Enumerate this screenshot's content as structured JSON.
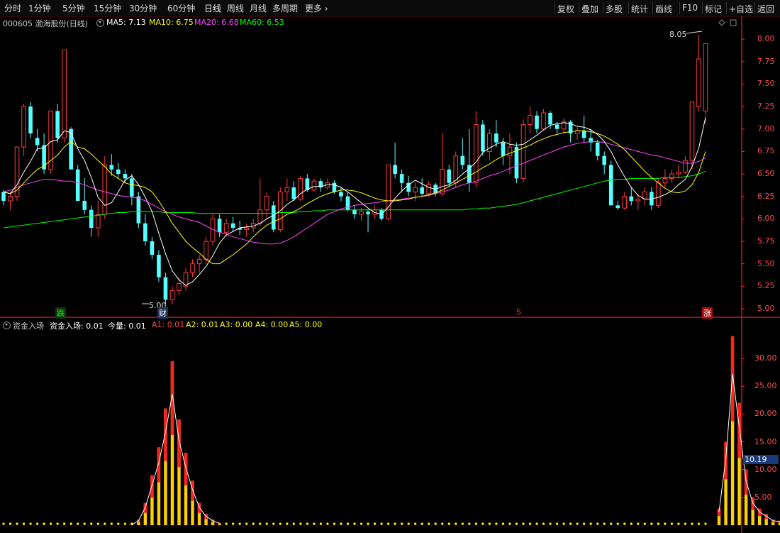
{
  "toolbar": {
    "left_items": [
      "分时",
      "1分钟",
      "5分钟",
      "15分钟",
      "30分钟",
      "60分钟",
      "日线",
      "周线",
      "月线",
      "多周期",
      "更多"
    ],
    "active_label": "日线",
    "right_items": [
      "复权",
      "叠加",
      "多股",
      "统计",
      "画线",
      "F10",
      "标记",
      "+自选",
      "返回"
    ]
  },
  "info": {
    "stock_name": "000605 渤海股份(日线)",
    "ma5": "MA5: 7.13",
    "ma10": "MA10: 6.75",
    "ma20": "MA20: 6.68",
    "ma60": "MA60: 6.53"
  },
  "indicator_info": {
    "name": "资金入场",
    "l1": "资金入场: 0.01",
    "l2": "今量: 0.01",
    "a1": "A1: 0.01",
    "a2": "A2: 0.01",
    "a3": "A3: 0.00",
    "a4": "A4: 0.00",
    "a5": "A5: 0.00"
  },
  "colors": {
    "up": "#ff3c3c",
    "down": "#54ffff",
    "ma5": "#ffffff",
    "ma10": "#ffff00",
    "ma20": "#ff44ff",
    "ma60": "#00ff00",
    "axis": "#ff3232",
    "axis_text": "#ff4d4d"
  },
  "markers": {
    "high_label": "8.05",
    "low_label": "5.00",
    "fall": "跌",
    "fin": "财",
    "s": "S",
    "rise": "涨",
    "ind_value": "10.19"
  },
  "chart_data": [
    {
      "type": "candlestick",
      "y_ticks": [
        "8.00",
        "7.75",
        "7.50",
        "7.25",
        "7.00",
        "6.75",
        "6.50",
        "6.25",
        "6.00",
        "5.75",
        "5.50",
        "5.25",
        "5.00"
      ],
      "ylim": [
        4.96,
        8.12
      ],
      "ohlc": [
        [
          6.3,
          6.32,
          6.15,
          6.2
        ],
        [
          6.2,
          6.3,
          6.1,
          6.25
        ],
        [
          6.25,
          6.8,
          6.2,
          6.8
        ],
        [
          6.8,
          7.28,
          6.7,
          7.25
        ],
        [
          7.25,
          7.3,
          6.9,
          6.95
        ],
        [
          6.9,
          7.0,
          6.75,
          6.82
        ],
        [
          6.82,
          6.95,
          6.5,
          6.55
        ],
        [
          6.55,
          7.2,
          6.5,
          7.2
        ],
        [
          7.2,
          7.28,
          6.85,
          6.9
        ],
        [
          6.9,
          7.88,
          6.85,
          7.88
        ],
        [
          7.0,
          7.02,
          6.55,
          6.55
        ],
        [
          6.55,
          6.6,
          6.2,
          6.2
        ],
        [
          6.2,
          6.45,
          6.05,
          6.1
        ],
        [
          6.1,
          6.15,
          5.8,
          5.9
        ],
        [
          5.9,
          6.2,
          5.8,
          6.05
        ],
        [
          6.05,
          6.7,
          6.0,
          6.6
        ],
        [
          6.6,
          6.72,
          6.48,
          6.55
        ],
        [
          6.55,
          6.62,
          6.45,
          6.5
        ],
        [
          6.5,
          6.55,
          6.4,
          6.45
        ],
        [
          6.45,
          6.5,
          6.15,
          6.25
        ],
        [
          6.25,
          6.3,
          5.9,
          5.95
        ],
        [
          5.95,
          6.05,
          5.7,
          5.75
        ],
        [
          5.75,
          5.8,
          5.55,
          5.6
        ],
        [
          5.6,
          5.65,
          5.3,
          5.35
        ],
        [
          5.35,
          5.4,
          5.05,
          5.1
        ],
        [
          5.1,
          5.25,
          5.05,
          5.2
        ],
        [
          5.2,
          5.35,
          5.15,
          5.28
        ],
        [
          5.25,
          5.45,
          5.2,
          5.4
        ],
        [
          5.4,
          5.55,
          5.35,
          5.5
        ],
        [
          5.5,
          5.6,
          5.4,
          5.55
        ],
        [
          5.55,
          5.8,
          5.5,
          5.75
        ],
        [
          5.75,
          6.05,
          5.7,
          6.0
        ],
        [
          6.0,
          6.05,
          5.8,
          5.85
        ],
        [
          5.85,
          6.0,
          5.8,
          5.95
        ],
        [
          5.95,
          6.02,
          5.85,
          5.9
        ],
        [
          5.9,
          5.98,
          5.82,
          5.88
        ],
        [
          5.88,
          5.95,
          5.8,
          5.9
        ],
        [
          5.9,
          6.0,
          5.85,
          5.95
        ],
        [
          5.95,
          6.45,
          5.92,
          6.1
        ],
        [
          6.1,
          6.3,
          6.0,
          6.25
        ],
        [
          6.15,
          6.2,
          5.85,
          5.88
        ],
        [
          5.88,
          6.35,
          5.85,
          6.3
        ],
        [
          6.3,
          6.45,
          6.2,
          6.35
        ],
        [
          6.35,
          6.42,
          6.2,
          6.22
        ],
        [
          6.22,
          6.48,
          6.2,
          6.45
        ],
        [
          6.45,
          6.5,
          6.3,
          6.32
        ],
        [
          6.32,
          6.45,
          6.3,
          6.42
        ],
        [
          6.42,
          6.45,
          6.3,
          6.35
        ],
        [
          6.35,
          6.45,
          6.32,
          6.4
        ],
        [
          6.4,
          6.43,
          6.28,
          6.3
        ],
        [
          6.3,
          6.35,
          6.2,
          6.25
        ],
        [
          6.25,
          6.3,
          6.08,
          6.1
        ],
        [
          6.1,
          6.15,
          6.0,
          6.05
        ],
        [
          6.05,
          6.12,
          5.98,
          6.08
        ],
        [
          6.08,
          6.1,
          5.85,
          6.05
        ],
        [
          6.05,
          6.15,
          6.0,
          6.1
        ],
        [
          6.1,
          6.12,
          5.98,
          6.0
        ],
        [
          6.0,
          6.6,
          5.98,
          6.6
        ],
        [
          6.6,
          6.85,
          6.45,
          6.5
        ],
        [
          6.5,
          6.55,
          6.3,
          6.4
        ],
        [
          6.4,
          6.48,
          6.25,
          6.3
        ],
        [
          6.3,
          6.4,
          6.2,
          6.35
        ],
        [
          6.35,
          6.45,
          6.25,
          6.28
        ],
        [
          6.28,
          6.42,
          6.25,
          6.38
        ],
        [
          6.38,
          6.4,
          6.25,
          6.28
        ],
        [
          6.28,
          6.95,
          6.25,
          6.55
        ],
        [
          6.55,
          6.6,
          6.35,
          6.4
        ],
        [
          6.4,
          6.75,
          6.35,
          6.7
        ],
        [
          6.7,
          6.9,
          6.55,
          6.6
        ],
        [
          6.6,
          7.0,
          6.3,
          6.4
        ],
        [
          6.4,
          7.2,
          6.35,
          7.05
        ],
        [
          7.05,
          7.1,
          6.7,
          6.75
        ],
        [
          6.75,
          7.0,
          6.65,
          6.95
        ],
        [
          6.95,
          7.1,
          6.8,
          6.85
        ],
        [
          6.85,
          6.9,
          6.6,
          6.7
        ],
        [
          6.7,
          6.95,
          6.5,
          6.8
        ],
        [
          6.8,
          6.85,
          6.4,
          6.45
        ],
        [
          6.45,
          7.1,
          6.4,
          7.05
        ],
        [
          7.05,
          7.25,
          6.95,
          7.15
        ],
        [
          7.15,
          7.2,
          6.95,
          7.0
        ],
        [
          7.0,
          7.22,
          6.98,
          7.18
        ],
        [
          7.18,
          7.2,
          7.0,
          7.05
        ],
        [
          7.05,
          7.08,
          6.95,
          7.0
        ],
        [
          7.0,
          7.12,
          6.95,
          7.08
        ],
        [
          7.08,
          7.1,
          6.85,
          6.95
        ],
        [
          6.95,
          7.02,
          6.88,
          6.98
        ],
        [
          6.98,
          7.15,
          6.85,
          6.9
        ],
        [
          6.9,
          7.0,
          6.75,
          6.85
        ],
        [
          6.85,
          6.88,
          6.65,
          6.7
        ],
        [
          6.7,
          6.75,
          6.5,
          6.6
        ],
        [
          6.6,
          6.65,
          6.15,
          6.15
        ],
        [
          6.15,
          6.2,
          6.1,
          6.12
        ],
        [
          6.12,
          6.3,
          6.1,
          6.25
        ],
        [
          6.25,
          6.35,
          6.15,
          6.2
        ],
        [
          6.2,
          6.28,
          6.1,
          6.22
        ],
        [
          6.22,
          6.35,
          6.15,
          6.3
        ],
        [
          6.3,
          6.35,
          6.1,
          6.15
        ],
        [
          6.15,
          6.45,
          6.12,
          6.4
        ],
        [
          6.4,
          6.55,
          6.35,
          6.45
        ],
        [
          6.45,
          6.55,
          6.4,
          6.5
        ],
        [
          6.5,
          6.6,
          6.45,
          6.52
        ],
        [
          6.52,
          6.7,
          6.5,
          6.65
        ],
        [
          6.65,
          7.3,
          6.55,
          7.3
        ],
        [
          7.25,
          8.05,
          7.2,
          7.78
        ],
        [
          7.2,
          7.95,
          7.05,
          7.95
        ]
      ],
      "ma5": [
        6.3,
        6.28,
        6.38,
        6.52,
        6.64,
        6.78,
        6.79,
        6.86,
        6.88,
        6.98,
        6.96,
        6.78,
        6.65,
        6.46,
        6.24,
        6.15,
        6.18,
        6.3,
        6.43,
        6.48,
        6.38,
        6.24,
        6.08,
        5.84,
        5.61,
        5.42,
        5.32,
        5.26,
        5.3,
        5.38,
        5.47,
        5.59,
        5.73,
        5.82,
        5.86,
        5.9,
        5.91,
        5.92,
        5.95,
        6.0,
        6.04,
        6.09,
        6.16,
        6.21,
        6.28,
        6.33,
        6.36,
        6.36,
        6.38,
        6.38,
        6.35,
        6.3,
        6.24,
        6.18,
        6.12,
        6.07,
        6.05,
        6.13,
        6.23,
        6.31,
        6.38,
        6.43,
        6.39,
        6.35,
        6.33,
        6.36,
        6.38,
        6.43,
        6.5,
        6.56,
        6.63,
        6.74,
        6.79,
        6.83,
        6.86,
        6.83,
        6.82,
        6.83,
        6.88,
        6.93,
        6.99,
        7.04,
        7.06,
        7.07,
        7.06,
        7.03,
        7.02,
        6.99,
        6.94,
        6.86,
        6.75,
        6.6,
        6.47,
        6.35,
        6.26,
        6.22,
        6.22,
        6.24,
        6.27,
        6.31,
        6.38,
        6.44,
        6.58,
        6.79,
        7.13
      ],
      "ma10": [
        6.3,
        6.28,
        6.32,
        6.4,
        6.48,
        6.55,
        6.59,
        6.65,
        6.71,
        6.8,
        6.86,
        6.8,
        6.78,
        6.72,
        6.65,
        6.58,
        6.5,
        6.45,
        6.4,
        6.38,
        6.37,
        6.35,
        6.3,
        6.2,
        6.08,
        5.95,
        5.85,
        5.75,
        5.68,
        5.62,
        5.55,
        5.5,
        5.5,
        5.55,
        5.6,
        5.66,
        5.72,
        5.8,
        5.87,
        5.93,
        5.97,
        6.0,
        6.05,
        6.08,
        6.12,
        6.17,
        6.21,
        6.25,
        6.28,
        6.3,
        6.32,
        6.32,
        6.31,
        6.29,
        6.26,
        6.23,
        6.21,
        6.2,
        6.2,
        6.21,
        6.22,
        6.24,
        6.25,
        6.27,
        6.29,
        6.32,
        6.36,
        6.4,
        6.44,
        6.48,
        6.52,
        6.57,
        6.61,
        6.66,
        6.7,
        6.73,
        6.76,
        6.79,
        6.82,
        6.86,
        6.89,
        6.92,
        6.94,
        6.96,
        6.97,
        6.98,
        6.98,
        6.97,
        6.95,
        6.92,
        6.88,
        6.83,
        6.77,
        6.69,
        6.61,
        6.53,
        6.46,
        6.4,
        6.34,
        6.3,
        6.29,
        6.31,
        6.38,
        6.52,
        6.75
      ],
      "ma20": [
        6.3,
        6.32,
        6.35,
        6.38,
        6.4,
        6.42,
        6.44,
        6.44,
        6.43,
        6.42,
        6.42,
        6.4,
        6.38,
        6.35,
        6.32,
        6.3,
        6.28,
        6.26,
        6.25,
        6.24,
        6.23,
        6.2,
        6.16,
        6.12,
        6.08,
        6.05,
        6.02,
        6.0,
        5.98,
        5.96,
        5.92,
        5.88,
        5.85,
        5.83,
        5.8,
        5.78,
        5.76,
        5.74,
        5.73,
        5.72,
        5.72,
        5.73,
        5.76,
        5.8,
        5.85,
        5.9,
        5.95,
        6.0,
        6.05,
        6.08,
        6.11,
        6.13,
        6.15,
        6.16,
        6.17,
        6.18,
        6.19,
        6.2,
        6.21,
        6.22,
        6.23,
        6.24,
        6.25,
        6.26,
        6.28,
        6.3,
        6.32,
        6.35,
        6.38,
        6.4,
        6.42,
        6.45,
        6.48,
        6.5,
        6.53,
        6.56,
        6.59,
        6.62,
        6.65,
        6.68,
        6.71,
        6.74,
        6.77,
        6.8,
        6.82,
        6.84,
        6.85,
        6.86,
        6.86,
        6.85,
        6.83,
        6.81,
        6.79,
        6.77,
        6.75,
        6.73,
        6.71,
        6.7,
        6.68,
        6.66,
        6.64,
        6.62,
        6.62,
        6.64,
        6.68
      ],
      "ma60": [
        5.9,
        5.91,
        5.92,
        5.93,
        5.94,
        5.95,
        5.96,
        5.97,
        5.98,
        5.99,
        6.0,
        6.01,
        6.02,
        6.03,
        6.04,
        6.05,
        6.06,
        6.07,
        6.07,
        6.08,
        6.08,
        6.08,
        6.08,
        6.08,
        6.07,
        6.07,
        6.07,
        6.07,
        6.07,
        6.06,
        6.06,
        6.06,
        6.06,
        6.06,
        6.06,
        6.06,
        6.06,
        6.06,
        6.06,
        6.06,
        6.06,
        6.07,
        6.07,
        6.07,
        6.08,
        6.08,
        6.09,
        6.09,
        6.1,
        6.1,
        6.1,
        6.1,
        6.1,
        6.1,
        6.1,
        6.1,
        6.1,
        6.1,
        6.1,
        6.1,
        6.1,
        6.1,
        6.1,
        6.1,
        6.1,
        6.1,
        6.1,
        6.1,
        6.1,
        6.11,
        6.11,
        6.12,
        6.12,
        6.13,
        6.14,
        6.15,
        6.16,
        6.18,
        6.2,
        6.22,
        6.24,
        6.26,
        6.28,
        6.3,
        6.32,
        6.34,
        6.36,
        6.38,
        6.4,
        6.42,
        6.43,
        6.44,
        6.44,
        6.45,
        6.45,
        6.45,
        6.45,
        6.45,
        6.46,
        6.46,
        6.46,
        6.47,
        6.48,
        6.5,
        6.53
      ]
    },
    {
      "type": "bar",
      "y_ticks": [
        "30.00",
        "25.00",
        "20.00",
        "15.00",
        "10.00",
        "5.00"
      ],
      "ylim": [
        0,
        35.5
      ],
      "bars": [
        [
          19,
          0.1
        ],
        [
          20,
          1
        ],
        [
          21,
          4
        ],
        [
          22,
          9
        ],
        [
          23,
          14
        ],
        [
          24,
          21
        ],
        [
          25,
          29.5
        ],
        [
          26,
          19
        ],
        [
          27,
          13
        ],
        [
          28,
          8
        ],
        [
          29,
          4
        ],
        [
          30,
          2
        ],
        [
          31,
          1
        ],
        [
          32,
          0.4
        ],
        [
          106,
          3
        ],
        [
          107,
          15
        ],
        [
          108,
          34
        ],
        [
          109,
          22
        ],
        [
          110,
          10
        ],
        [
          111,
          5
        ],
        [
          112,
          3
        ],
        [
          113,
          2
        ],
        [
          114,
          1
        ],
        [
          115,
          0.8
        ],
        [
          116,
          0.5
        ]
      ]
    }
  ]
}
